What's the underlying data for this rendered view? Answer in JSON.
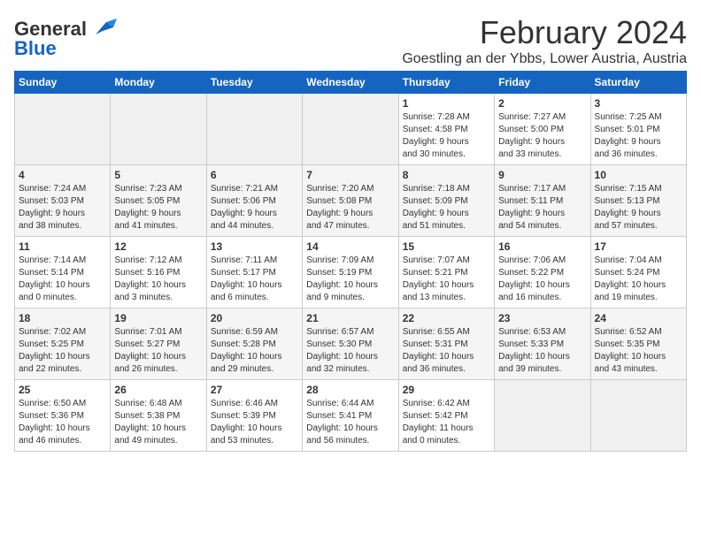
{
  "header": {
    "logo_line1": "General",
    "logo_line2": "Blue",
    "title": "February 2024",
    "subtitle": "Goestling an der Ybbs, Lower Austria, Austria"
  },
  "calendar": {
    "headers": [
      "Sunday",
      "Monday",
      "Tuesday",
      "Wednesday",
      "Thursday",
      "Friday",
      "Saturday"
    ],
    "weeks": [
      [
        {
          "day": "",
          "info": ""
        },
        {
          "day": "",
          "info": ""
        },
        {
          "day": "",
          "info": ""
        },
        {
          "day": "",
          "info": ""
        },
        {
          "day": "1",
          "info": "Sunrise: 7:28 AM\nSunset: 4:58 PM\nDaylight: 9 hours\nand 30 minutes."
        },
        {
          "day": "2",
          "info": "Sunrise: 7:27 AM\nSunset: 5:00 PM\nDaylight: 9 hours\nand 33 minutes."
        },
        {
          "day": "3",
          "info": "Sunrise: 7:25 AM\nSunset: 5:01 PM\nDaylight: 9 hours\nand 36 minutes."
        }
      ],
      [
        {
          "day": "4",
          "info": "Sunrise: 7:24 AM\nSunset: 5:03 PM\nDaylight: 9 hours\nand 38 minutes."
        },
        {
          "day": "5",
          "info": "Sunrise: 7:23 AM\nSunset: 5:05 PM\nDaylight: 9 hours\nand 41 minutes."
        },
        {
          "day": "6",
          "info": "Sunrise: 7:21 AM\nSunset: 5:06 PM\nDaylight: 9 hours\nand 44 minutes."
        },
        {
          "day": "7",
          "info": "Sunrise: 7:20 AM\nSunset: 5:08 PM\nDaylight: 9 hours\nand 47 minutes."
        },
        {
          "day": "8",
          "info": "Sunrise: 7:18 AM\nSunset: 5:09 PM\nDaylight: 9 hours\nand 51 minutes."
        },
        {
          "day": "9",
          "info": "Sunrise: 7:17 AM\nSunset: 5:11 PM\nDaylight: 9 hours\nand 54 minutes."
        },
        {
          "day": "10",
          "info": "Sunrise: 7:15 AM\nSunset: 5:13 PM\nDaylight: 9 hours\nand 57 minutes."
        }
      ],
      [
        {
          "day": "11",
          "info": "Sunrise: 7:14 AM\nSunset: 5:14 PM\nDaylight: 10 hours\nand 0 minutes."
        },
        {
          "day": "12",
          "info": "Sunrise: 7:12 AM\nSunset: 5:16 PM\nDaylight: 10 hours\nand 3 minutes."
        },
        {
          "day": "13",
          "info": "Sunrise: 7:11 AM\nSunset: 5:17 PM\nDaylight: 10 hours\nand 6 minutes."
        },
        {
          "day": "14",
          "info": "Sunrise: 7:09 AM\nSunset: 5:19 PM\nDaylight: 10 hours\nand 9 minutes."
        },
        {
          "day": "15",
          "info": "Sunrise: 7:07 AM\nSunset: 5:21 PM\nDaylight: 10 hours\nand 13 minutes."
        },
        {
          "day": "16",
          "info": "Sunrise: 7:06 AM\nSunset: 5:22 PM\nDaylight: 10 hours\nand 16 minutes."
        },
        {
          "day": "17",
          "info": "Sunrise: 7:04 AM\nSunset: 5:24 PM\nDaylight: 10 hours\nand 19 minutes."
        }
      ],
      [
        {
          "day": "18",
          "info": "Sunrise: 7:02 AM\nSunset: 5:25 PM\nDaylight: 10 hours\nand 22 minutes."
        },
        {
          "day": "19",
          "info": "Sunrise: 7:01 AM\nSunset: 5:27 PM\nDaylight: 10 hours\nand 26 minutes."
        },
        {
          "day": "20",
          "info": "Sunrise: 6:59 AM\nSunset: 5:28 PM\nDaylight: 10 hours\nand 29 minutes."
        },
        {
          "day": "21",
          "info": "Sunrise: 6:57 AM\nSunset: 5:30 PM\nDaylight: 10 hours\nand 32 minutes."
        },
        {
          "day": "22",
          "info": "Sunrise: 6:55 AM\nSunset: 5:31 PM\nDaylight: 10 hours\nand 36 minutes."
        },
        {
          "day": "23",
          "info": "Sunrise: 6:53 AM\nSunset: 5:33 PM\nDaylight: 10 hours\nand 39 minutes."
        },
        {
          "day": "24",
          "info": "Sunrise: 6:52 AM\nSunset: 5:35 PM\nDaylight: 10 hours\nand 43 minutes."
        }
      ],
      [
        {
          "day": "25",
          "info": "Sunrise: 6:50 AM\nSunset: 5:36 PM\nDaylight: 10 hours\nand 46 minutes."
        },
        {
          "day": "26",
          "info": "Sunrise: 6:48 AM\nSunset: 5:38 PM\nDaylight: 10 hours\nand 49 minutes."
        },
        {
          "day": "27",
          "info": "Sunrise: 6:46 AM\nSunset: 5:39 PM\nDaylight: 10 hours\nand 53 minutes."
        },
        {
          "day": "28",
          "info": "Sunrise: 6:44 AM\nSunset: 5:41 PM\nDaylight: 10 hours\nand 56 minutes."
        },
        {
          "day": "29",
          "info": "Sunrise: 6:42 AM\nSunset: 5:42 PM\nDaylight: 11 hours\nand 0 minutes."
        },
        {
          "day": "",
          "info": ""
        },
        {
          "day": "",
          "info": ""
        }
      ]
    ]
  }
}
